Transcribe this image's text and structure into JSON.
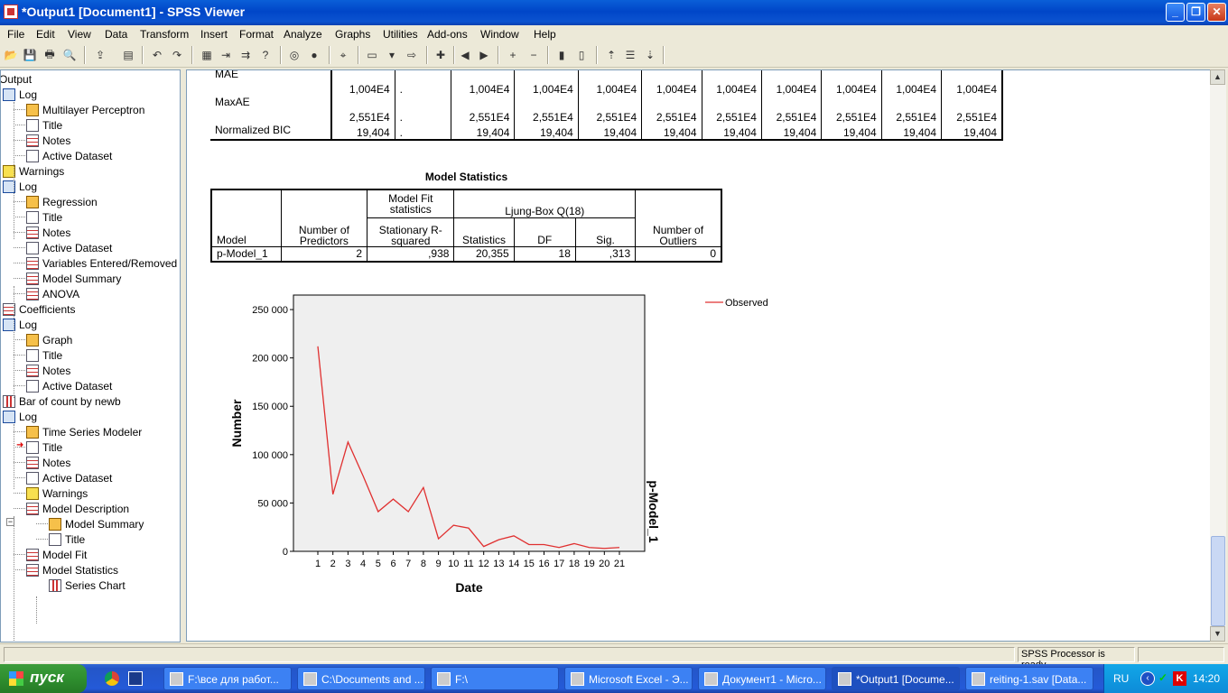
{
  "window": {
    "title": "*Output1 [Document1] - SPSS Viewer"
  },
  "menu": [
    "File",
    "Edit",
    "View",
    "Data",
    "Transform",
    "Insert",
    "Format",
    "Analyze",
    "Graphs",
    "Utilities",
    "Add-ons",
    "Window",
    "Help"
  ],
  "tree": {
    "root": "Output",
    "items": [
      {
        "label": "Log",
        "icon": "log"
      },
      {
        "label": "Multilayer Perceptron",
        "icon": "book"
      },
      {
        "label": "Title",
        "icon": "doc"
      },
      {
        "label": "Notes",
        "icon": "tbl"
      },
      {
        "label": "Active Dataset",
        "icon": "doc"
      },
      {
        "label": "Warnings",
        "icon": "warn"
      },
      {
        "label": "Log",
        "icon": "log"
      },
      {
        "label": "Regression",
        "icon": "book"
      },
      {
        "label": "Title",
        "icon": "doc"
      },
      {
        "label": "Notes",
        "icon": "tbl"
      },
      {
        "label": "Active Dataset",
        "icon": "doc"
      },
      {
        "label": "Variables Entered/Removed",
        "icon": "tbl"
      },
      {
        "label": "Model Summary",
        "icon": "tbl"
      },
      {
        "label": "ANOVA",
        "icon": "tbl"
      },
      {
        "label": "Coefficients",
        "icon": "tbl"
      },
      {
        "label": "Log",
        "icon": "log"
      },
      {
        "label": "Graph",
        "icon": "book"
      },
      {
        "label": "Title",
        "icon": "doc"
      },
      {
        "label": "Notes",
        "icon": "tbl"
      },
      {
        "label": "Active Dataset",
        "icon": "doc"
      },
      {
        "label": "Bar of count by newb",
        "icon": "chart"
      },
      {
        "label": "Log",
        "icon": "log"
      },
      {
        "label": "Time Series Modeler",
        "icon": "book"
      },
      {
        "label": "Title",
        "icon": "doc"
      },
      {
        "label": "Notes",
        "icon": "tbl"
      },
      {
        "label": "Active Dataset",
        "icon": "doc"
      },
      {
        "label": "Warnings",
        "icon": "warn"
      },
      {
        "label": "Model Description",
        "icon": "tbl"
      },
      {
        "label": "Model Summary",
        "icon": "book"
      },
      {
        "label": "Title",
        "icon": "doc"
      },
      {
        "label": "Model Fit",
        "icon": "tbl"
      },
      {
        "label": "Model Statistics",
        "icon": "tbl"
      },
      {
        "label": "Series Chart",
        "icon": "chart"
      }
    ]
  },
  "fit_table": {
    "rows": [
      {
        "label": "MAE",
        "values": [
          "1,004E4",
          ".",
          "1,004E4",
          "1,004E4",
          "1,004E4",
          "1,004E4",
          "1,004E4",
          "1,004E4",
          "1,004E4",
          "1,004E4",
          "1,004E4"
        ]
      },
      {
        "label": "MaxAE",
        "values": [
          "2,551E4",
          ".",
          "2,551E4",
          "2,551E4",
          "2,551E4",
          "2,551E4",
          "2,551E4",
          "2,551E4",
          "2,551E4",
          "2,551E4",
          "2,551E4"
        ]
      },
      {
        "label": "Normalized BIC",
        "values": [
          "19,404",
          ".",
          "19,404",
          "19,404",
          "19,404",
          "19,404",
          "19,404",
          "19,404",
          "19,404",
          "19,404",
          "19,404"
        ]
      }
    ]
  },
  "model_stats": {
    "title": "Model Statistics",
    "h_model": "Model",
    "h_predictors": "Number of Predictors",
    "h_fit": "Model Fit statistics",
    "h_stationary": "Stationary R-squared",
    "h_ljung": "Ljung-Box Q(18)",
    "h_statistics": "Statistics",
    "h_df": "DF",
    "h_sig": "Sig.",
    "h_outliers": "Number of Outliers",
    "row": {
      "model": "p-Model_1",
      "predictors": "2",
      "stationary": ",938",
      "statistics": "20,355",
      "df": "18",
      "sig": ",313",
      "outliers": "0"
    }
  },
  "chart_data": {
    "type": "line",
    "xlabel": "Date",
    "ylabel": "Number",
    "panel_label": "p-Model_1",
    "x": [
      1,
      2,
      3,
      4,
      5,
      6,
      7,
      8,
      9,
      10,
      11,
      12,
      13,
      14,
      15,
      16,
      17,
      18,
      19,
      20,
      21
    ],
    "series": [
      {
        "name": "Observed",
        "color": "#e03030",
        "values": [
          212000,
          59000,
          113000,
          78000,
          41000,
          54000,
          41000,
          66000,
          13000,
          27000,
          24000,
          5000,
          12000,
          16000,
          7000,
          7000,
          4000,
          8000,
          4000,
          3000,
          4000
        ]
      }
    ],
    "yticks": [
      0,
      50000,
      100000,
      150000,
      200000,
      250000
    ],
    "ytick_labels": [
      "0",
      "50 000",
      "100 000",
      "150 000",
      "200 000",
      "250 000"
    ],
    "ylim": [
      0,
      265000
    ],
    "legend": "right",
    "grid": false
  },
  "status": {
    "processor": "SPSS  Processor is ready"
  },
  "taskbar": {
    "start": "пуск",
    "tasks": [
      {
        "label": "F:\\все для работ..."
      },
      {
        "label": "C:\\Documents and ..."
      },
      {
        "label": "F:\\"
      },
      {
        "label": "Microsoft Excel - Э..."
      },
      {
        "label": "Документ1 - Micro..."
      },
      {
        "label": "*Output1 [Docume..."
      },
      {
        "label": "reiting-1.sav [Data..."
      }
    ],
    "lang": "RU",
    "clock": "14:20"
  }
}
